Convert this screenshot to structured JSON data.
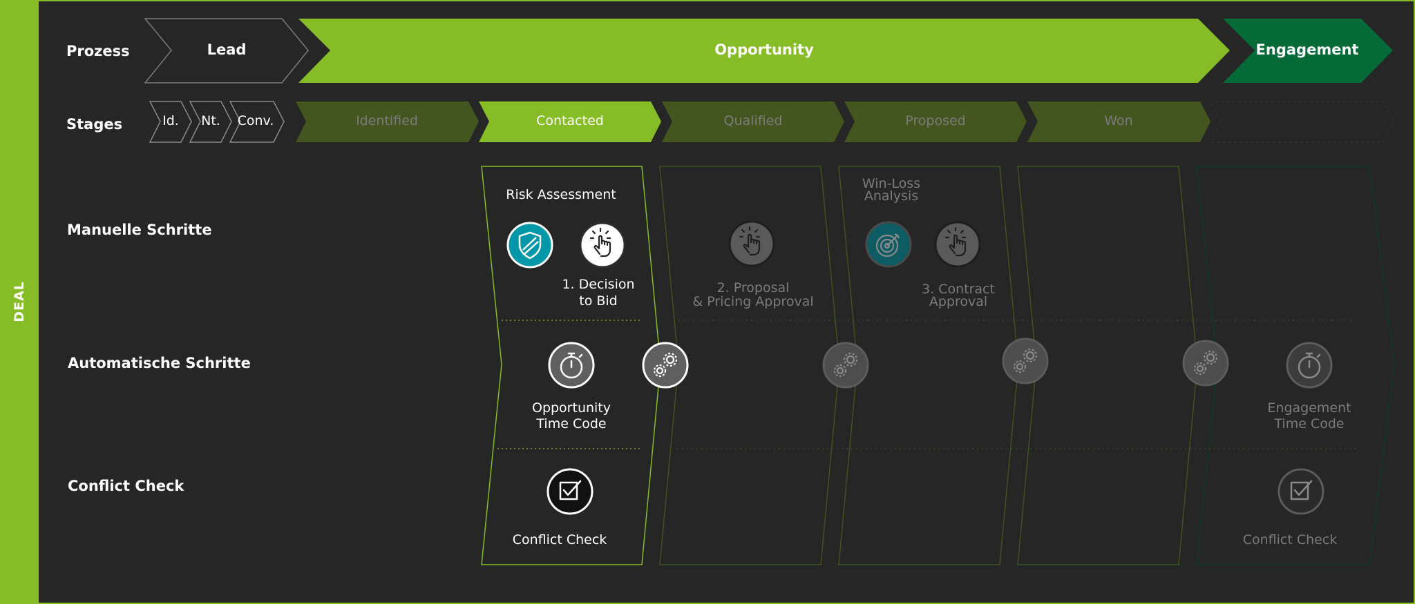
{
  "sidebar": {
    "label": "DEAL"
  },
  "rows": {
    "process": "Prozess",
    "stages": "Stages",
    "manual": "Manuelle Schritte",
    "automatic": "Automatische Schritte",
    "conflict": "Conflict Check"
  },
  "process_steps": {
    "lead": "Lead",
    "opportunity": "Opportunity",
    "engagement": "Engagement"
  },
  "lead_stages": {
    "id": "Id.",
    "nt": "Nt.",
    "conv": "Conv."
  },
  "stages": {
    "identified": "Identified",
    "contacted": "Contacted",
    "qualified": "Qualified",
    "proposed": "Proposed",
    "won": "Won"
  },
  "active_stage": "Contacted",
  "manual_steps": {
    "risk_assessment": "Risk Assessment",
    "decision_line1": "1. Decision",
    "decision_line2": "to Bid",
    "proposal_line1": "2. Proposal",
    "proposal_line2": "& Pricing Approval",
    "winloss_line1": "Win-Loss",
    "winloss_line2": "Analysis",
    "contract_line1": "3. Contract",
    "contract_line2": "Approval"
  },
  "automatic_steps": {
    "opp_line1": "Opportunity",
    "opp_line2": "Time Code",
    "eng_line1": "Engagement",
    "eng_line2": "Time Code"
  },
  "conflict_checks": {
    "contacted": "Conflict Check",
    "engagement": "Conflict Check"
  },
  "colors": {
    "background": "#262626",
    "accent_green": "#86bc25",
    "dark_green": "#046a38",
    "inactive_stage": "#43561f",
    "teal": "#0097a9"
  },
  "icons": [
    "shield-icon",
    "hand-pointer-icon",
    "target-icon",
    "stopwatch-icon",
    "gears-icon",
    "checkbox-icon"
  ]
}
